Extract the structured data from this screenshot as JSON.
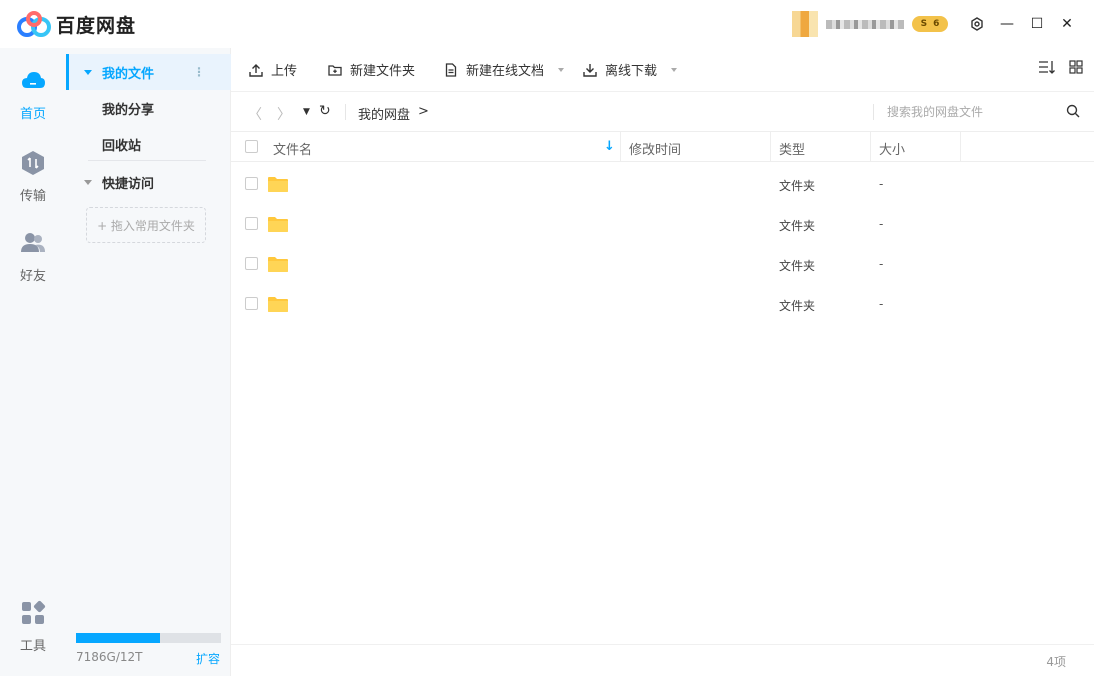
{
  "app": {
    "title": "百度网盘"
  },
  "window": {
    "minimize": "—",
    "maximize": "☐",
    "close": "✕"
  },
  "user": {
    "vip_level": "6",
    "vip_symbol": "S"
  },
  "rail": {
    "items": [
      {
        "label": "首页",
        "icon": "cloud-icon",
        "active": true
      },
      {
        "label": "传输",
        "icon": "transfer-icon",
        "active": false
      },
      {
        "label": "好友",
        "icon": "friends-icon",
        "active": false
      },
      {
        "label": "工具",
        "icon": "tools-icon",
        "active": false
      }
    ]
  },
  "panel": {
    "items": [
      {
        "label": "我的文件",
        "active": true
      },
      {
        "label": "我的分享"
      },
      {
        "label": "回收站"
      }
    ],
    "quick_access": {
      "label": "快捷访问"
    },
    "drop_zone": "+ 拖入常用文件夹",
    "quota": {
      "text": "7186G/12T",
      "used_fraction": 0.58,
      "expand": "扩容"
    }
  },
  "toolbar": {
    "upload": "上传",
    "new_folder": "新建文件夹",
    "new_doc": "新建在线文档",
    "offline_download": "离线下载"
  },
  "pathbar": {
    "crumb": "我的网盘",
    "crumb_arrow": ">",
    "search_placeholder": "搜索我的网盘文件"
  },
  "table": {
    "headers": {
      "name": "文件名",
      "modified": "修改时间",
      "type": "类型",
      "size": "大小"
    },
    "rows": [
      {
        "type": "文件夹",
        "size": "-"
      },
      {
        "type": "文件夹",
        "size": "-"
      },
      {
        "type": "文件夹",
        "size": "-"
      },
      {
        "type": "文件夹",
        "size": "-"
      }
    ]
  },
  "status": {
    "count": "4项"
  },
  "colors": {
    "accent": "#06a7ff",
    "folder": "#ffc83d"
  }
}
